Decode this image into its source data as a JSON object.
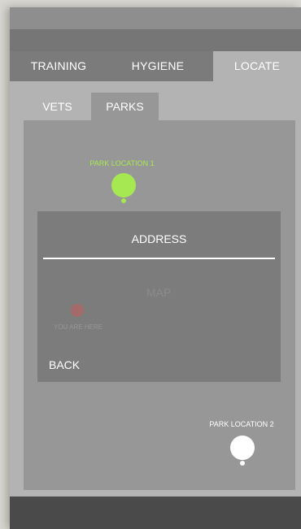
{
  "tabs": {
    "training": "TRAINING",
    "hygiene": "HYGIENE",
    "locate": "LOCATE",
    "active": "LOCATE"
  },
  "sub_tabs": {
    "vets": "VETS",
    "parks": "PARKS",
    "active": "PARKS"
  },
  "map": {
    "park1_label": "PARK LOCATION 1",
    "park2_label": "PARK LOCATION 2",
    "park1_color": "#a6e852",
    "park2_color": "#ffffff",
    "address_title": "ADDRESS",
    "map_placeholder": "MAP",
    "you_are_here": "YOU ARE HERE",
    "you_are_here_color": "#a46a6a",
    "back_label": "BACK"
  }
}
